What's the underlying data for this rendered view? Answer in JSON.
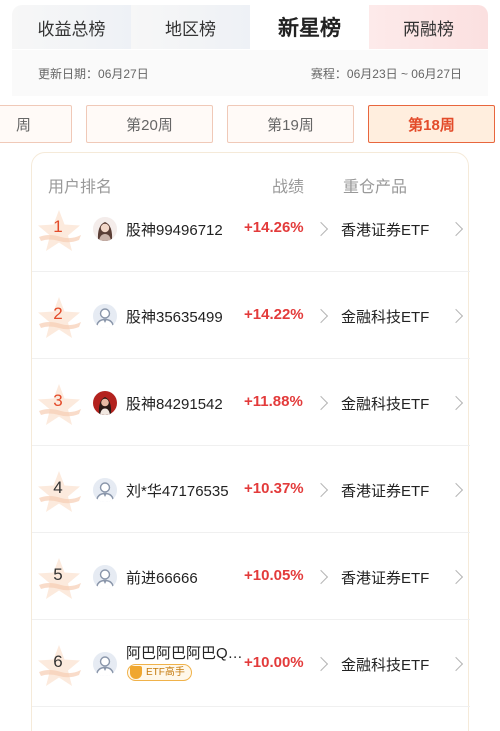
{
  "tabs": [
    {
      "label": "收益总榜"
    },
    {
      "label": "地区榜"
    },
    {
      "label": "新星榜",
      "active": true
    },
    {
      "label": "两融榜"
    }
  ],
  "update": {
    "label": "更新日期：",
    "date": "06月27日"
  },
  "period": {
    "label": "赛程：",
    "range": "06月23日 ~ 06月27日"
  },
  "weeks": [
    {
      "label": "周"
    },
    {
      "label": "第20周"
    },
    {
      "label": "第19周"
    },
    {
      "label": "第18周",
      "active": true
    }
  ],
  "table": {
    "headers": {
      "user": "用户排名",
      "score": "战绩",
      "product": "重仓产品"
    },
    "rows": [
      {
        "rank": "1",
        "name": "股神99496712",
        "pct": "+14.26%",
        "product": "香港证券ETF",
        "avatar": "female-avatar"
      },
      {
        "rank": "2",
        "name": "股神35635499",
        "pct": "+14.22%",
        "product": "金融科技ETF",
        "avatar": "default-avatar"
      },
      {
        "rank": "3",
        "name": "股神84291542",
        "pct": "+11.88%",
        "product": "金融科技ETF",
        "avatar": "photo-avatar"
      },
      {
        "rank": "4",
        "name": "刘*华47176535",
        "pct": "+10.37%",
        "product": "香港证券ETF",
        "avatar": "default-avatar"
      },
      {
        "rank": "5",
        "name": "前进66666",
        "pct": "+10.05%",
        "product": "香港证券ETF",
        "avatar": "default-avatar"
      },
      {
        "rank": "6",
        "name": "阿巴阿巴阿巴Q…",
        "pct": "+10.00%",
        "product": "金融科技ETF",
        "avatar": "default-avatar",
        "badge": "ETF高手"
      }
    ]
  },
  "colors": {
    "accent": "#e34b2a",
    "gain": "#e33b3b",
    "badge": "#f0a72f"
  }
}
